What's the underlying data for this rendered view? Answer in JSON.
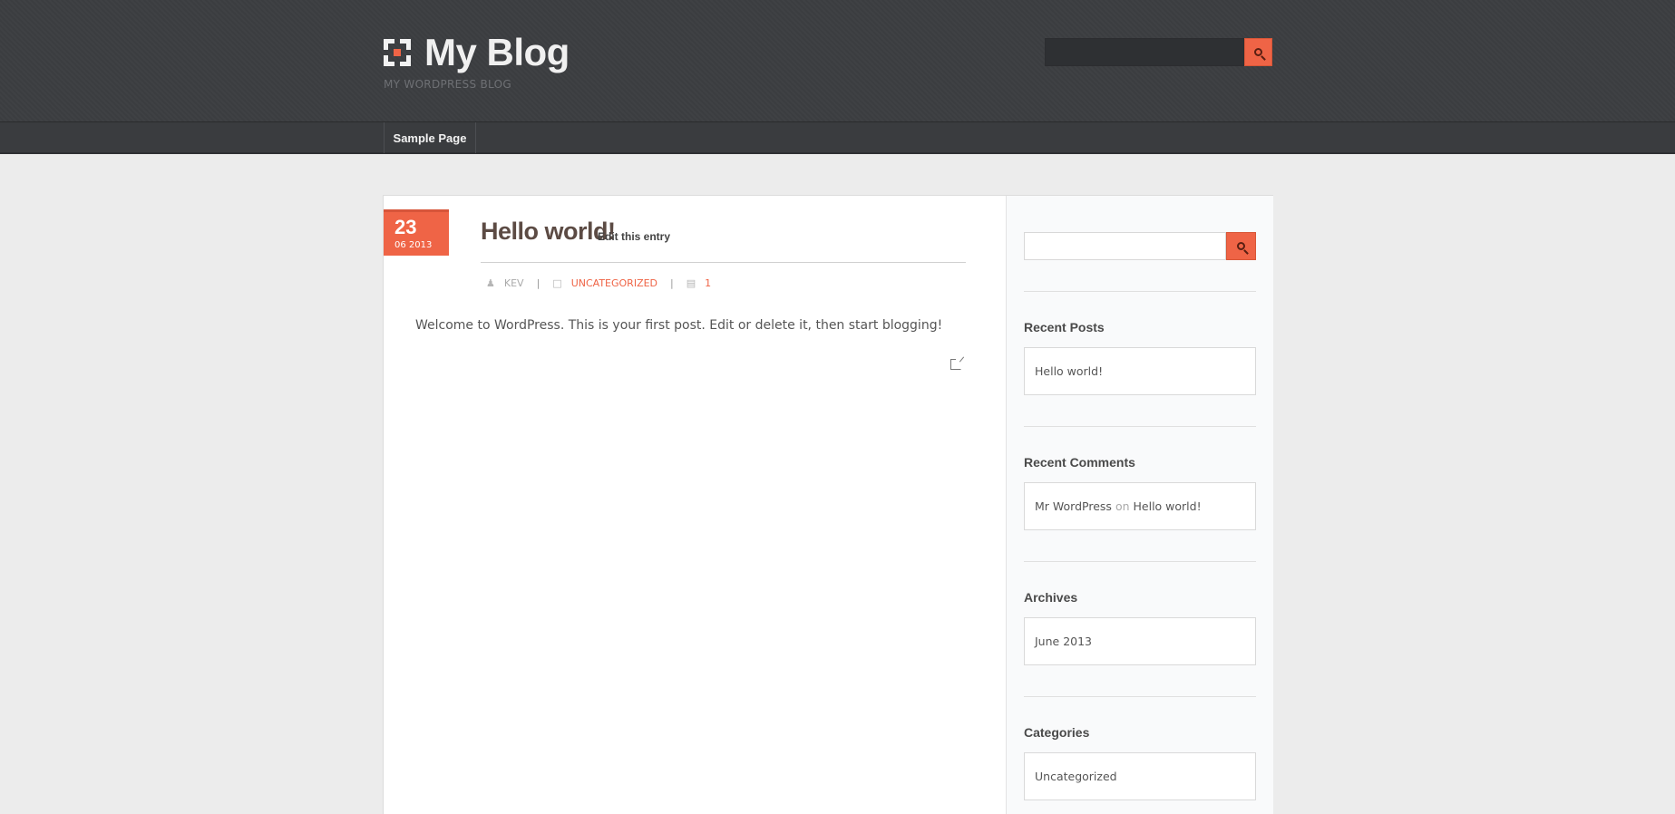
{
  "header": {
    "site_title": "My Blog",
    "tagline": "MY WORDPRESS BLOG",
    "search": {
      "placeholder": "",
      "value": ""
    }
  },
  "nav": {
    "items": [
      {
        "label": "Sample Page"
      }
    ]
  },
  "post": {
    "date": {
      "day": "23",
      "month_year": "06 2013"
    },
    "title": "Hello world!",
    "edit_label": "Edit this entry",
    "meta": {
      "author": "KEV",
      "separator": "|",
      "category": "UNCATEGORIZED",
      "comments": "1"
    },
    "body": "Welcome to WordPress. This is your first post. Edit or delete it, then start blogging!"
  },
  "sidebar": {
    "search": {
      "placeholder": "",
      "value": ""
    },
    "recent_posts": {
      "title": "Recent Posts",
      "items": [
        "Hello world!"
      ]
    },
    "recent_comments": {
      "title": "Recent Comments",
      "author": "Mr WordPress",
      "on": "on",
      "post": "Hello world!"
    },
    "archives": {
      "title": "Archives",
      "items": [
        "June 2013"
      ]
    },
    "categories": {
      "title": "Categories",
      "items": [
        "Uncategorized"
      ]
    }
  },
  "colors": {
    "accent": "#ef6446",
    "header_bg": "#3c3e41",
    "page_bg": "#ececec"
  },
  "icons": [
    "logo-icon",
    "search-icon",
    "author-icon",
    "folder-icon",
    "comment-icon",
    "share-icon"
  ]
}
